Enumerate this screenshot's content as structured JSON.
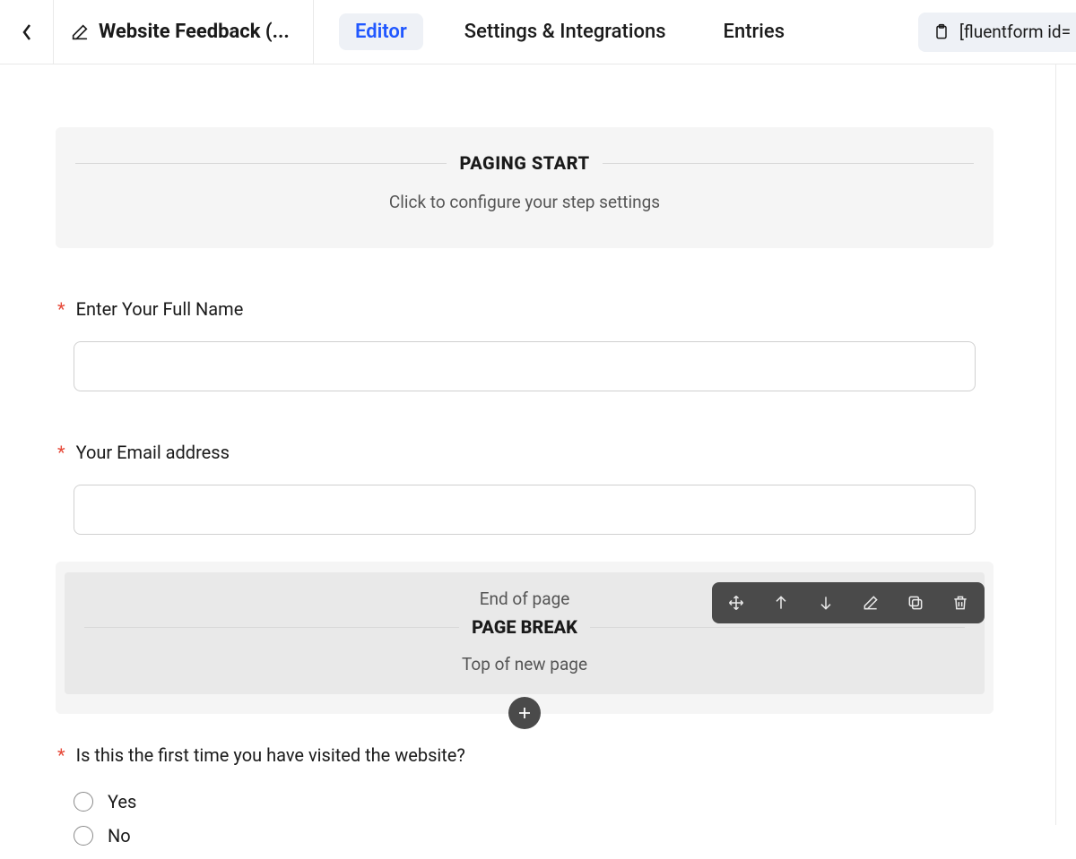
{
  "header": {
    "title": "Website Feedback (...",
    "tabs": {
      "editor": "Editor",
      "settings": "Settings & Integrations",
      "entries": "Entries"
    },
    "shortcode": "[fluentform id="
  },
  "paging_start": {
    "title": "PAGING START",
    "subtitle": "Click to configure your step settings"
  },
  "fields": {
    "name": {
      "label": "Enter Your Full Name",
      "required": "*"
    },
    "email": {
      "label": "Your Email address",
      "required": "*"
    }
  },
  "page_break": {
    "end": "End of page",
    "title": "PAGE BREAK",
    "top": "Top of new page"
  },
  "question": {
    "required": "*",
    "label": "Is this the first time you have visited the website?",
    "options": {
      "yes": "Yes",
      "no": "No"
    }
  }
}
